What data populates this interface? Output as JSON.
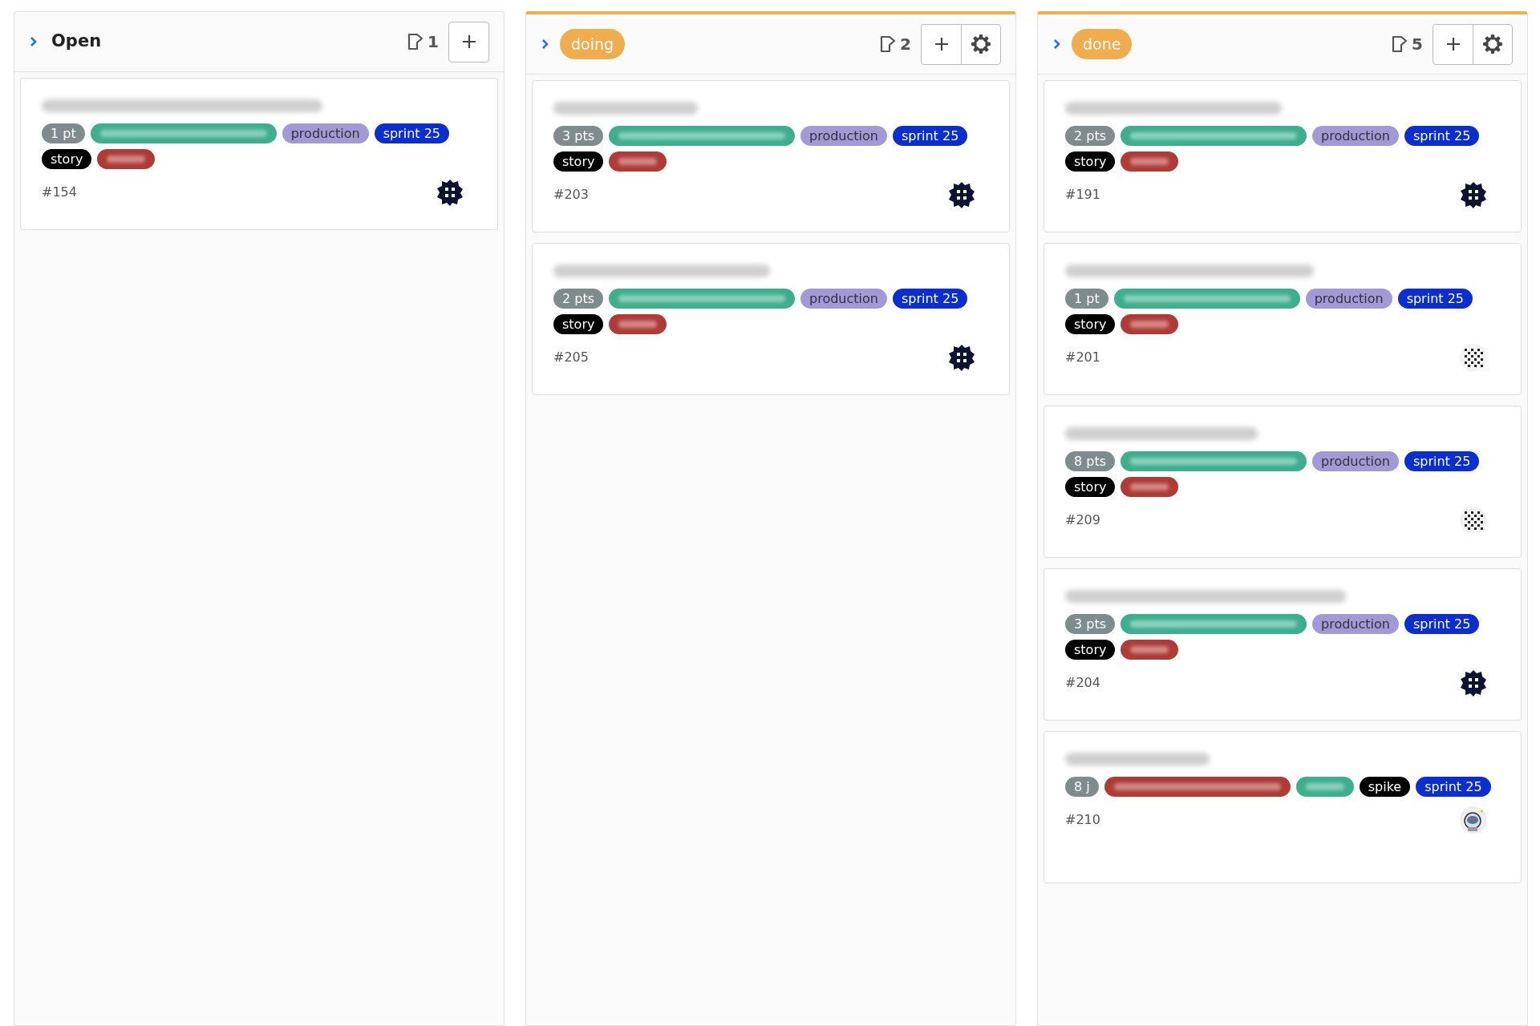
{
  "columns": [
    {
      "title": "Open",
      "kind": "plain",
      "count": "1",
      "cards": [
        {
          "blurred_title": true,
          "tags": [
            {
              "kind": "label",
              "text": "1 pt",
              "color": "#7f8c8d"
            },
            {
              "kind": "blurred",
              "color": "#3daf8e"
            },
            {
              "kind": "label",
              "text": "production",
              "color": "#a299d6"
            },
            {
              "kind": "label",
              "text": "sprint 25",
              "color": "#0b2ed1"
            },
            {
              "kind": "label",
              "text": "story",
              "color": "#000000"
            },
            {
              "kind": "blurred",
              "color": "#b03a35"
            }
          ],
          "number": "#154",
          "avatar": {
            "kind": "dark"
          }
        }
      ]
    },
    {
      "title": "doing",
      "kind": "badge",
      "color": "#f0ad4e",
      "count": "2",
      "settings": true,
      "cards": [
        {
          "blurred_title": true,
          "tags": [
            {
              "kind": "label",
              "text": "3 pts",
              "color": "#7f8c8d"
            },
            {
              "kind": "blurred",
              "color": "#3daf8e"
            },
            {
              "kind": "label",
              "text": "production",
              "color": "#a299d6"
            },
            {
              "kind": "label",
              "text": "sprint 25",
              "color": "#0b2ed1"
            },
            {
              "kind": "label",
              "text": "story",
              "color": "#000000"
            },
            {
              "kind": "blurred",
              "color": "#b03a35"
            }
          ],
          "number": "#203",
          "avatar": {
            "kind": "dark"
          }
        },
        {
          "blurred_title": true,
          "tags": [
            {
              "kind": "label",
              "text": "2 pts",
              "color": "#7f8c8d"
            },
            {
              "kind": "blurred",
              "color": "#3daf8e"
            },
            {
              "kind": "label",
              "text": "production",
              "color": "#a299d6"
            },
            {
              "kind": "label",
              "text": "sprint 25",
              "color": "#0b2ed1"
            },
            {
              "kind": "label",
              "text": "story",
              "color": "#000000"
            },
            {
              "kind": "blurred",
              "color": "#b03a35"
            }
          ],
          "number": "#205",
          "avatar": {
            "kind": "dark"
          }
        }
      ]
    },
    {
      "title": "done",
      "kind": "badge",
      "color": "#f0ad4e",
      "count": "5",
      "settings": true,
      "cards": [
        {
          "blurred_title": true,
          "tags": [
            {
              "kind": "label",
              "text": "2 pts",
              "color": "#7f8c8d"
            },
            {
              "kind": "blurred",
              "color": "#3daf8e"
            },
            {
              "kind": "label",
              "text": "production",
              "color": "#a299d6"
            },
            {
              "kind": "label",
              "text": "sprint 25",
              "color": "#0b2ed1"
            },
            {
              "kind": "label",
              "text": "story",
              "color": "#000000"
            },
            {
              "kind": "blurred",
              "color": "#b03a35"
            }
          ],
          "number": "#191",
          "avatar": {
            "kind": "dark"
          }
        },
        {
          "blurred_title": true,
          "tags": [
            {
              "kind": "label",
              "text": "1 pt",
              "color": "#7f8c8d"
            },
            {
              "kind": "blurred",
              "color": "#3daf8e"
            },
            {
              "kind": "label",
              "text": "production",
              "color": "#a299d6"
            },
            {
              "kind": "label",
              "text": "sprint 25",
              "color": "#0b2ed1"
            },
            {
              "kind": "label",
              "text": "story",
              "color": "#000000"
            },
            {
              "kind": "blurred",
              "color": "#b03a35"
            }
          ],
          "number": "#201",
          "avatar": {
            "kind": "dotted"
          }
        },
        {
          "blurred_title": true,
          "tags": [
            {
              "kind": "label",
              "text": "8 pts",
              "color": "#7f8c8d"
            },
            {
              "kind": "blurred",
              "color": "#3daf8e"
            },
            {
              "kind": "label",
              "text": "production",
              "color": "#a299d6"
            },
            {
              "kind": "label",
              "text": "sprint 25",
              "color": "#0b2ed1"
            },
            {
              "kind": "label",
              "text": "story",
              "color": "#000000"
            },
            {
              "kind": "blurred",
              "color": "#b03a35"
            }
          ],
          "number": "#209",
          "avatar": {
            "kind": "dotted"
          }
        },
        {
          "blurred_title": true,
          "tags": [
            {
              "kind": "label",
              "text": "3 pts",
              "color": "#7f8c8d"
            },
            {
              "kind": "blurred",
              "color": "#3daf8e"
            },
            {
              "kind": "label",
              "text": "production",
              "color": "#a299d6"
            },
            {
              "kind": "label",
              "text": "sprint 25",
              "color": "#0b2ed1"
            },
            {
              "kind": "label",
              "text": "story",
              "color": "#000000"
            },
            {
              "kind": "blurred",
              "color": "#b03a35"
            }
          ],
          "number": "#204",
          "avatar": {
            "kind": "dark"
          }
        },
        {
          "blurred_title": true,
          "tags": [
            {
              "kind": "label",
              "text": "8 j",
              "color": "#7f8c8d"
            },
            {
              "kind": "blurred",
              "color": "#b03a35"
            },
            {
              "kind": "blurred",
              "color": "#3daf8e"
            },
            {
              "kind": "label",
              "text": "spike",
              "color": "#000000"
            },
            {
              "kind": "label",
              "text": "sprint 25",
              "color": "#0b2ed1"
            }
          ],
          "number": "#210",
          "avatar": {
            "kind": "astronaut"
          }
        }
      ]
    }
  ]
}
